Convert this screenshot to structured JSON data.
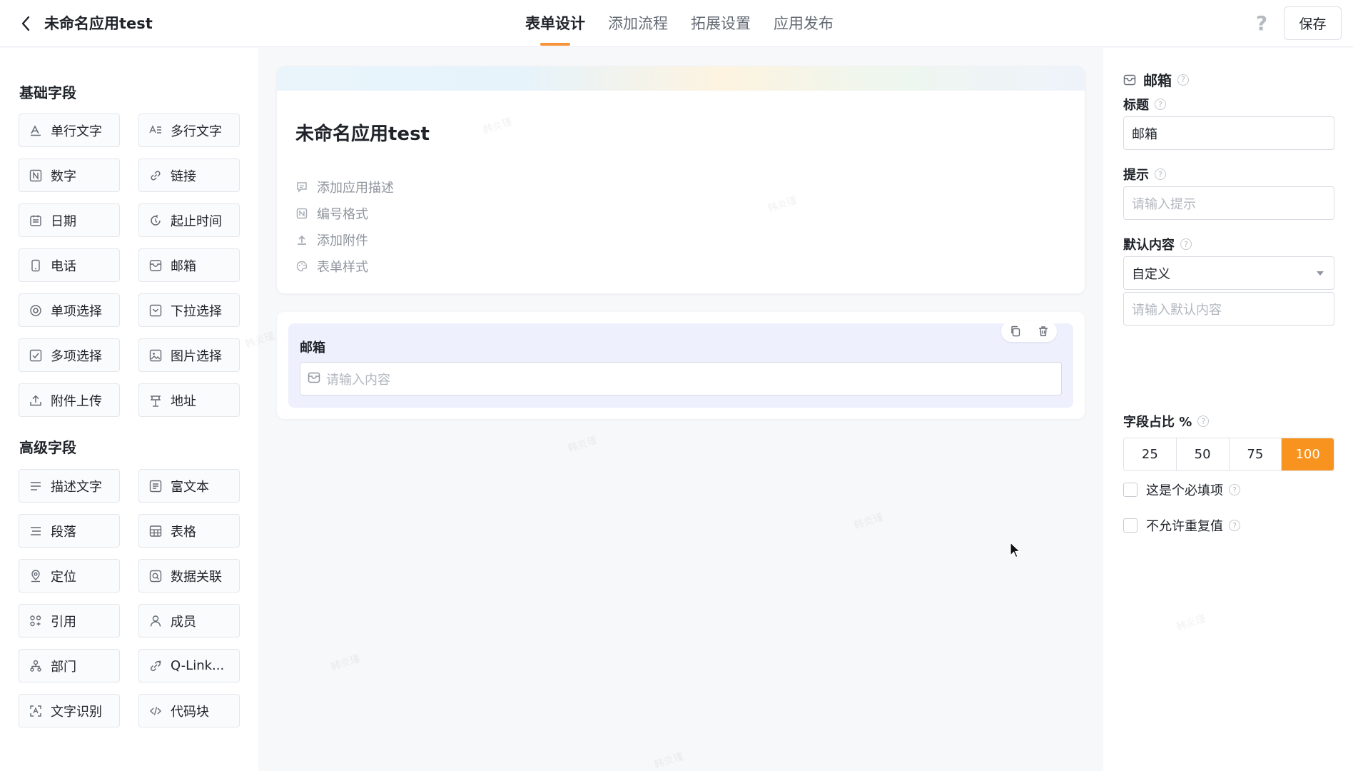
{
  "header": {
    "app_title": "未命名应用test",
    "tabs": [
      {
        "label": "表单设计"
      },
      {
        "label": "添加流程"
      },
      {
        "label": "拓展设置"
      },
      {
        "label": "应用发布"
      }
    ],
    "save_label": "保存"
  },
  "sidebar": {
    "basic_title": "基础字段",
    "basic_fields": [
      {
        "label": "单行文字",
        "icon": "single-line-text-icon"
      },
      {
        "label": "多行文字",
        "icon": "multi-line-text-icon"
      },
      {
        "label": "数字",
        "icon": "number-icon"
      },
      {
        "label": "链接",
        "icon": "link-icon"
      },
      {
        "label": "日期",
        "icon": "calendar-icon"
      },
      {
        "label": "起止时间",
        "icon": "time-range-icon"
      },
      {
        "label": "电话",
        "icon": "phone-icon"
      },
      {
        "label": "邮箱",
        "icon": "mail-icon"
      },
      {
        "label": "单项选择",
        "icon": "radio-icon"
      },
      {
        "label": "下拉选择",
        "icon": "dropdown-icon"
      },
      {
        "label": "多项选择",
        "icon": "checkbox-icon"
      },
      {
        "label": "图片选择",
        "icon": "image-icon"
      },
      {
        "label": "附件上传",
        "icon": "upload-icon"
      },
      {
        "label": "地址",
        "icon": "address-icon"
      }
    ],
    "advanced_title": "高级字段",
    "advanced_fields": [
      {
        "label": "描述文字",
        "icon": "description-icon"
      },
      {
        "label": "富文本",
        "icon": "rich-text-icon"
      },
      {
        "label": "段落",
        "icon": "paragraph-icon"
      },
      {
        "label": "表格",
        "icon": "table-icon"
      },
      {
        "label": "定位",
        "icon": "location-icon"
      },
      {
        "label": "数据关联",
        "icon": "data-link-icon"
      },
      {
        "label": "引用",
        "icon": "reference-icon"
      },
      {
        "label": "成员",
        "icon": "member-icon"
      },
      {
        "label": "部门",
        "icon": "department-icon"
      },
      {
        "label": "Q-Link...",
        "icon": "qlink-icon"
      },
      {
        "label": "文字识别",
        "icon": "ocr-icon"
      },
      {
        "label": "代码块",
        "icon": "code-icon"
      }
    ]
  },
  "canvas": {
    "form_title": "未命名应用test",
    "options": [
      {
        "label": "添加应用描述"
      },
      {
        "label": "编号格式"
      },
      {
        "label": "添加附件"
      },
      {
        "label": "表单样式"
      }
    ],
    "field": {
      "label": "邮箱",
      "placeholder": "请输入内容"
    }
  },
  "props": {
    "field_type": "邮箱",
    "title_label": "标题",
    "title_value": "邮箱",
    "hint_label": "提示",
    "hint_placeholder": "请输入提示",
    "default_label": "默认内容",
    "default_mode": "自定义",
    "default_placeholder": "请输入默认内容",
    "ratio_label": "字段占比 %",
    "ratio_options": [
      "25",
      "50",
      "75",
      "100"
    ],
    "ratio_selected": "100",
    "required_label": "这是个必填项",
    "no_duplicate_label": "不允许重复值",
    "accent_color": "#f7931e"
  },
  "watermark": "韩炎瑾"
}
